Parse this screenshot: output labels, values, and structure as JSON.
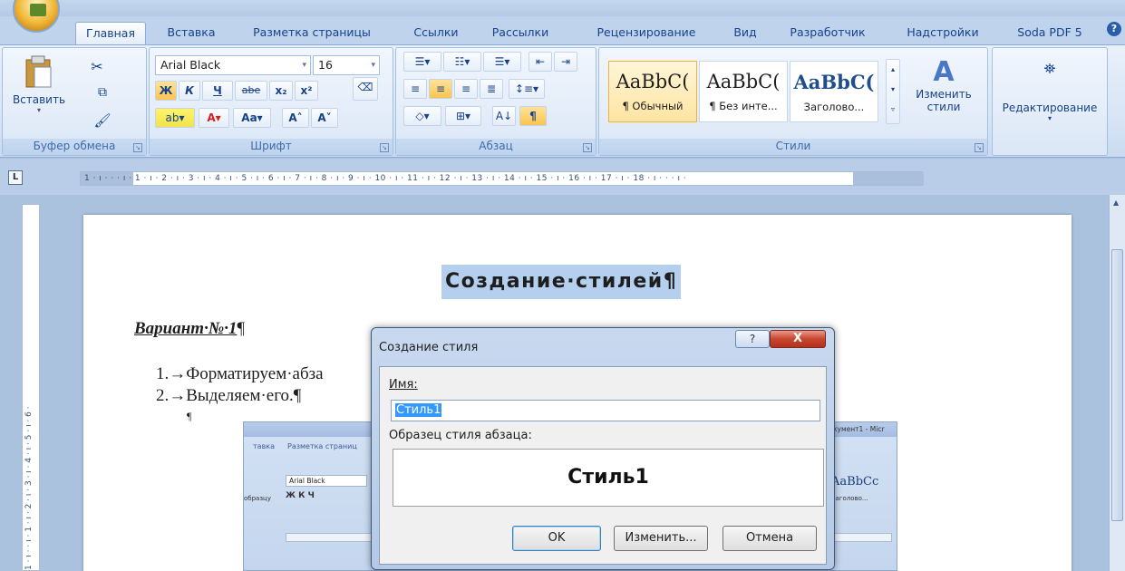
{
  "tabs": [
    "Главная",
    "Вставка",
    "Разметка страницы",
    "Ссылки",
    "Рассылки",
    "Рецензирование",
    "Вид",
    "Разработчик",
    "Надстройки",
    "Soda PDF 5"
  ],
  "clipboard": {
    "paste": "Вставить",
    "group": "Буфер обмена"
  },
  "font": {
    "name": "Arial Black",
    "size": "16",
    "bold": "Ж",
    "italic": "К",
    "underline": "Ч",
    "strike": "abe",
    "sub": "x₂",
    "sup": "x²",
    "color": "A",
    "case": "Aa",
    "grow": "A˄",
    "shrink": "A˅",
    "group": "Шрифт"
  },
  "paragraph": {
    "group": "Абзац",
    "pilcrow": "¶"
  },
  "styles": {
    "group": "Стили",
    "items": [
      {
        "preview": "AaBbC(",
        "label": "¶ Обычный"
      },
      {
        "preview": "AaBbC(",
        "label": "¶ Без инте..."
      },
      {
        "preview": "AaBbC(",
        "label": "Заголово..."
      }
    ],
    "change": "Изменить стили",
    "editing": "Редактирование"
  },
  "ruler": {
    "numbers": "1 · ı · ·  ·  ı · 1 · ı · 2 · ı · 3 · ı · 4 · ı · 5 · ı · 6 · ı · 7 · ı · 8 · ı · 9 · ı · 10 · ı · 11 · ı · 12 · ı · 13 · ı · 14 · ı · 15 · ı · 16 · ı · 17 · ı · 18 · ı · ·  ·  ı ·"
  },
  "vruler": {
    "numbers": "1 · ı · · ı · 1 · ı · 2 · ı · 3 · ı · 4 · ı · 5 · ı · 6 ·"
  },
  "document": {
    "title": "Создание·стилей¶",
    "variant": "Вариант·№·1",
    "variant_mark": "¶",
    "item1": "1.→Форматируем·абза",
    "item2": "2.→Выделяем·его.¶",
    "empty_para": "¶"
  },
  "embedded": {
    "tab1": "тавка",
    "tab2": "Разметка страниц",
    "font": "Arial Black",
    "format": "Ж  К  Ч",
    "styles_preview": "AaBbCc",
    "heading": "Заголово...",
    "paste_label": "образцу",
    "title_text": "кумент1 - Micr"
  },
  "dialog": {
    "title": "Создание стиля",
    "help": "?",
    "close": "X",
    "name_label": "Имя:",
    "name_value": "Стиль1",
    "sample_label": "Образец стиля абзаца:",
    "sample_text": "Стиль1",
    "ok": "OK",
    "modify": "Изменить...",
    "cancel": "Отмена"
  }
}
